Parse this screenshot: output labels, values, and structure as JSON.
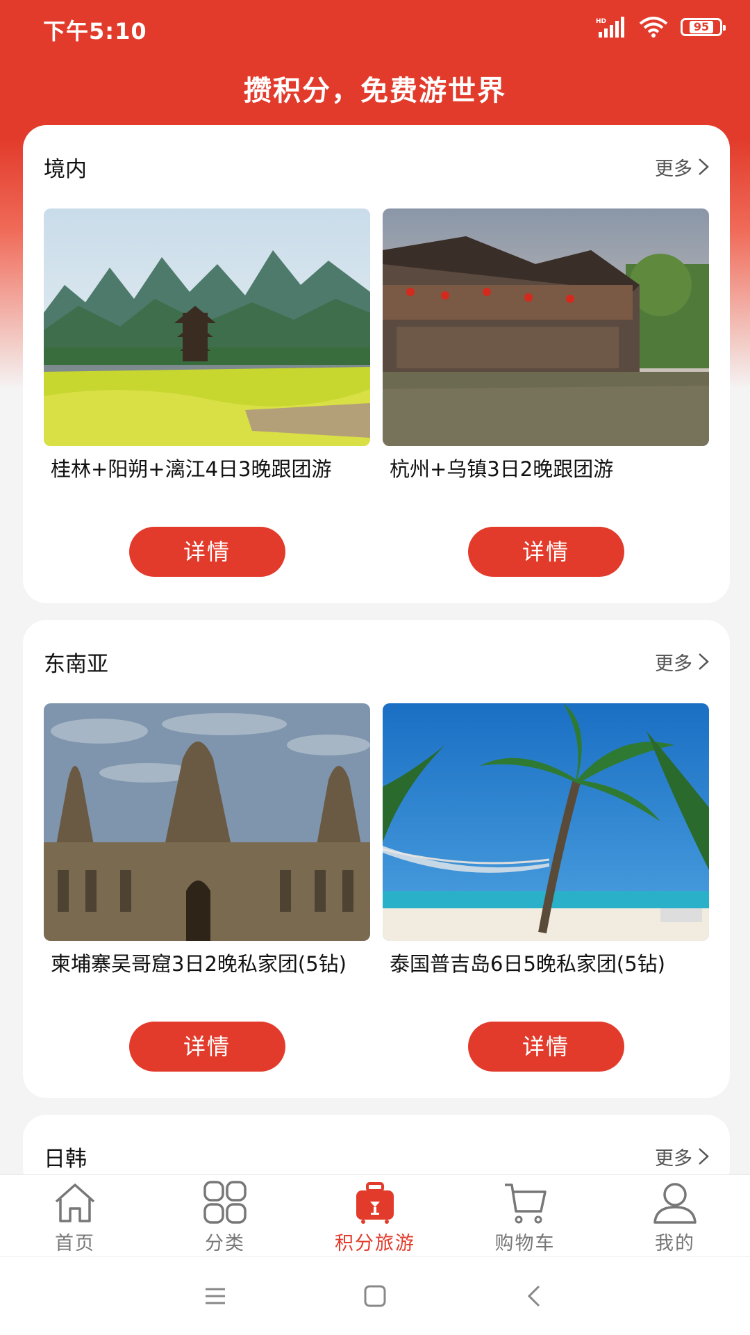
{
  "status_bar": {
    "time": "下午5:10",
    "battery": "95"
  },
  "header": {
    "title": "攒积分，免费游世界"
  },
  "sections": [
    {
      "title": "境内",
      "more": "更多",
      "cards": [
        {
          "title": "桂林+阳朔+漓江4日3晚跟团游",
          "button": "详情"
        },
        {
          "title": "杭州+乌镇3日2晚跟团游",
          "button": "详情"
        }
      ]
    },
    {
      "title": "东南亚",
      "more": "更多",
      "cards": [
        {
          "title": "柬埔寨吴哥窟3日2晚私家团(5钻)",
          "button": "详情"
        },
        {
          "title": "泰国普吉岛6日5晚私家团(5钻)",
          "button": "详情"
        }
      ]
    },
    {
      "title": "日韩",
      "more": "更多"
    }
  ],
  "bottom_nav": [
    {
      "label": "首页",
      "icon": "home-icon"
    },
    {
      "label": "分类",
      "icon": "grid-icon"
    },
    {
      "label": "积分旅游",
      "icon": "suitcase-icon",
      "active": true
    },
    {
      "label": "购物车",
      "icon": "cart-icon"
    },
    {
      "label": "我的",
      "icon": "user-icon"
    }
  ],
  "colors": {
    "accent": "#e23b2b"
  }
}
